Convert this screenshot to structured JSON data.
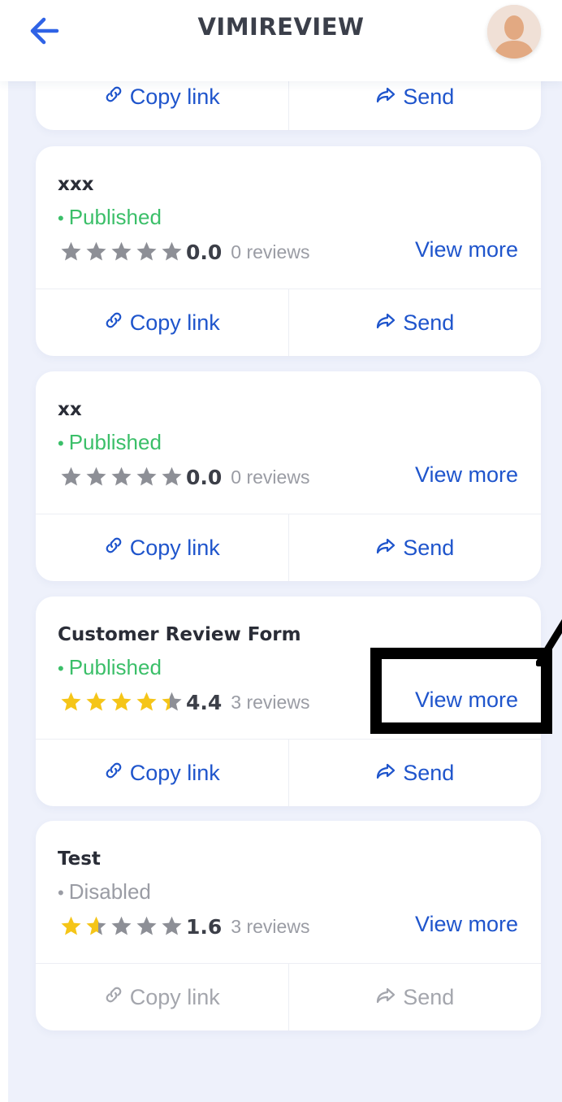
{
  "header": {
    "title": "VIMIREVIEW"
  },
  "colors": {
    "accent": "#1f55cc",
    "published": "#3bbf69",
    "disabled_text": "#9a9ca4",
    "star_filled": "#f5c518",
    "star_empty": "#8d8f96",
    "background": "#eef1fb"
  },
  "icons": {
    "back": "arrow-left-icon",
    "avatar": "user-avatar-icon",
    "copy": "link-icon",
    "send": "share-arrow-icon",
    "star": "star-icon"
  },
  "partial_card": {
    "copy_label": "Copy link",
    "send_label": "Send"
  },
  "forms": [
    {
      "title": "xxx",
      "status": "Published",
      "rating": 0.0,
      "score_text": "0.0",
      "reviews_text": "0 reviews",
      "view_more_label": "View more",
      "copy_label": "Copy link",
      "send_label": "Send"
    },
    {
      "title": "xx",
      "status": "Published",
      "rating": 0.0,
      "score_text": "0.0",
      "reviews_text": "0 reviews",
      "view_more_label": "View more",
      "copy_label": "Copy link",
      "send_label": "Send"
    },
    {
      "title": "Customer Review Form",
      "status": "Published",
      "rating": 4.4,
      "score_text": "4.4",
      "reviews_text": "3 reviews",
      "view_more_label": "View more",
      "copy_label": "Copy link",
      "send_label": "Send"
    },
    {
      "title": "Test",
      "status": "Disabled",
      "rating": 1.6,
      "score_text": "1.6",
      "reviews_text": "3 reviews",
      "view_more_label": "View more",
      "copy_label": "Copy link",
      "send_label": "Send"
    }
  ]
}
